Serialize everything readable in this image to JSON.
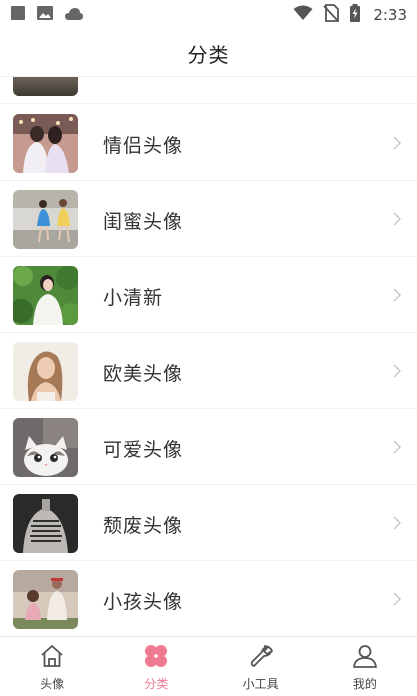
{
  "status_bar": {
    "time": "2:33",
    "left_icons": [
      "stop-square-icon",
      "image-icon",
      "cloud-icon"
    ],
    "right_icons": [
      "wifi-icon",
      "no-sim-icon",
      "battery-charging-icon"
    ]
  },
  "header": {
    "title": "分类"
  },
  "categories": [
    {
      "label": "情侣头像",
      "thumb_icon": "couple-photo"
    },
    {
      "label": "闺蜜头像",
      "thumb_icon": "friends-photo"
    },
    {
      "label": "小清新",
      "thumb_icon": "fresh-photo"
    },
    {
      "label": "欧美头像",
      "thumb_icon": "western-photo"
    },
    {
      "label": "可爱头像",
      "thumb_icon": "cat-photo"
    },
    {
      "label": "颓废头像",
      "thumb_icon": "decadent-photo"
    },
    {
      "label": "小孩头像",
      "thumb_icon": "kids-photo"
    }
  ],
  "bottom_nav": {
    "items": [
      {
        "label": "头像",
        "icon": "home-icon",
        "active": false
      },
      {
        "label": "分类",
        "icon": "clover-icon",
        "active": true
      },
      {
        "label": "小工具",
        "icon": "wrench-icon",
        "active": false
      },
      {
        "label": "我的",
        "icon": "user-icon",
        "active": false
      }
    ]
  },
  "colors": {
    "accent": "#ef7a91",
    "text": "#333333",
    "divider": "#f0f0f0"
  }
}
